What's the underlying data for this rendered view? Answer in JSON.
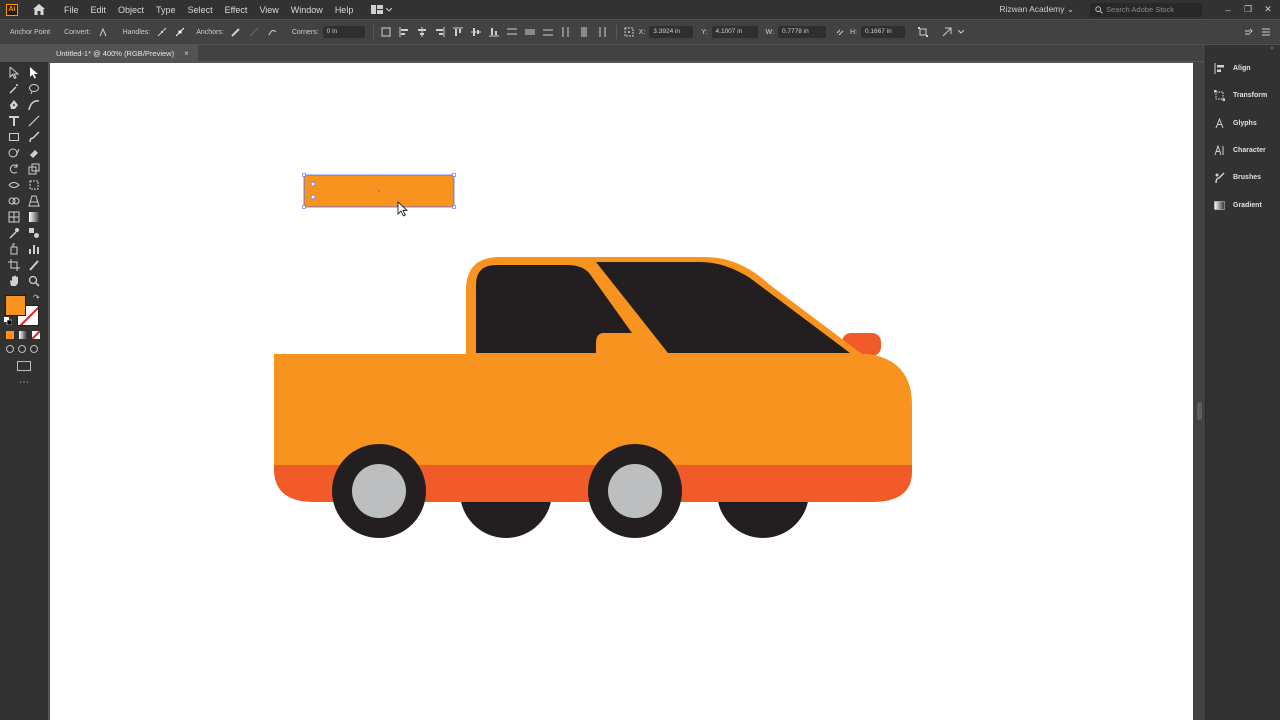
{
  "app": {
    "logo": "Ai",
    "menus": [
      "File",
      "Edit",
      "Object",
      "Type",
      "Select",
      "Effect",
      "View",
      "Window",
      "Help"
    ],
    "workspace": "Rizwan Academy",
    "search_placeholder": "Search Adobe Stock"
  },
  "controlbar": {
    "anchor_point_label": "Anchor Point",
    "convert_label": "Convert:",
    "handles_label": "Handles:",
    "anchors_label": "Anchors:",
    "corners_label": "Corners:",
    "corners_value": "0 in",
    "x_label": "X:",
    "x_value": "3.3924 in",
    "y_label": "Y:",
    "y_value": "4.1007 in",
    "w_label": "W:",
    "w_value": "0.7778 in",
    "h_label": "H:",
    "h_value": "0.1667 in"
  },
  "document": {
    "tab_title": "Untitled-1* @ 400% (RGB/Preview)",
    "close_glyph": "×"
  },
  "tools": {
    "fill_color": "#f7931e",
    "stroke_color": "none"
  },
  "panels": {
    "items": [
      {
        "label": "Align",
        "icon": "align-icon"
      },
      {
        "label": "Transform",
        "icon": "transform-icon"
      },
      {
        "label": "Glyphs",
        "icon": "glyphs-icon"
      },
      {
        "label": "Character",
        "icon": "character-icon"
      },
      {
        "label": "Brushes",
        "icon": "brushes-icon"
      },
      {
        "label": "Gradient",
        "icon": "gradient-icon"
      }
    ]
  },
  "colors": {
    "car_body": "#f7931e",
    "car_bottom_stripe": "#f15a29",
    "window": "#231f20",
    "tire": "#231f20",
    "hubcap": "#bcbec0",
    "tail_light": "#f15a29",
    "selection": "#4a6bff"
  }
}
